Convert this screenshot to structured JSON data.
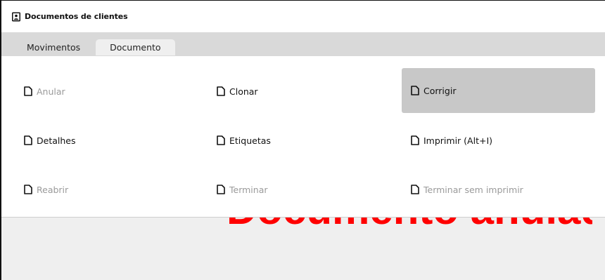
{
  "window": {
    "title": "Documentos de clientes",
    "icon": "person-document-icon"
  },
  "tabs": [
    {
      "label": "Movimentos",
      "active": false
    },
    {
      "label": "Documento",
      "active": true
    }
  ],
  "actions": [
    {
      "label": "Anular",
      "disabled": true,
      "selected": false,
      "icon": "document-icon"
    },
    {
      "label": "Clonar",
      "disabled": false,
      "selected": false,
      "icon": "document-icon"
    },
    {
      "label": "Corrigir",
      "disabled": false,
      "selected": true,
      "icon": "document-icon"
    },
    {
      "label": "Detalhes",
      "disabled": false,
      "selected": false,
      "icon": "document-icon"
    },
    {
      "label": "Etiquetas",
      "disabled": false,
      "selected": false,
      "icon": "document-icon"
    },
    {
      "label": "Imprimir (Alt+I)",
      "disabled": false,
      "selected": false,
      "icon": "document-icon"
    },
    {
      "label": "Reabrir",
      "disabled": true,
      "selected": false,
      "icon": "document-icon"
    },
    {
      "label": "Terminar",
      "disabled": true,
      "selected": false,
      "icon": "document-icon"
    },
    {
      "label": "Terminar sem imprimir",
      "disabled": true,
      "selected": false,
      "icon": "document-icon"
    }
  ],
  "status_watermark": {
    "text": "Documento anulado",
    "color": "#ff0000"
  },
  "colors": {
    "selected_bg": "#c8c8c8",
    "disabled_text": "#9a9a9a",
    "tabbar_bg": "#d9d9d9"
  }
}
